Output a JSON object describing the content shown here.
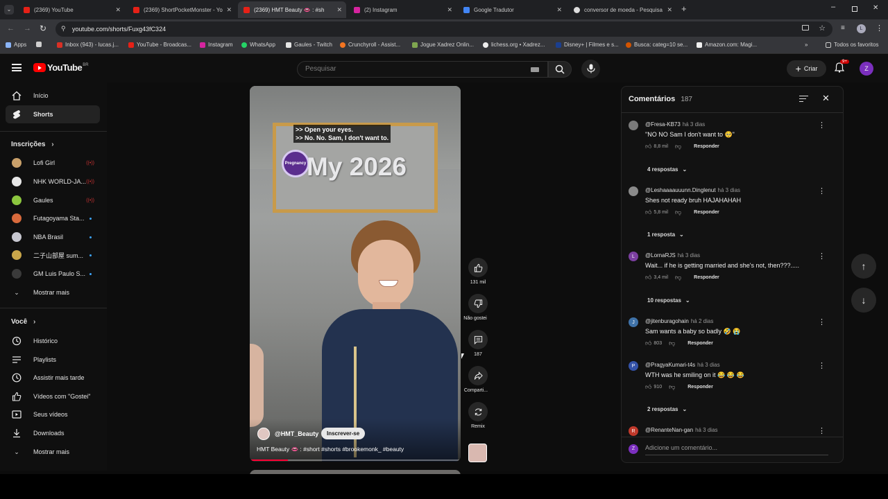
{
  "tabs": [
    {
      "title": "(2369) YouTube",
      "color": "#e62117"
    },
    {
      "title": "(2369) ShortPocketMonster - Yo",
      "color": "#e62117"
    },
    {
      "title": "(2369) HMT Beauty 👄 : #sh",
      "color": "#e62117"
    },
    {
      "title": "(2) Instagram",
      "color": "#d6249f"
    },
    {
      "title": "Google Tradutor",
      "color": "#4285f4"
    },
    {
      "title": "conversor de moeda - Pesquisa",
      "color": "#dddddd"
    }
  ],
  "url": "youtube.com/shorts/Fuxg43fC324",
  "bookmarks": [
    "Apps",
    "Inbox (943) - lucas.j...",
    "YouTube - Broadcas...",
    "Instagram",
    "WhatsApp",
    "Gaules - Twitch",
    "Crunchyroll - Assist...",
    "Jogue Xadrez Onlin...",
    "lichess.org • Xadrez...",
    "Disney+ | Filmes e s...",
    "Busca: categ=10 se...",
    "Amazon.com: Magi..."
  ],
  "bookmarks_all": "Todos os favoritos",
  "header": {
    "logo": "YouTube",
    "region": "BR",
    "search_placeholder": "Pesquisar",
    "create": "Criar",
    "notif_count": "9+",
    "user_initial": "Z"
  },
  "sidebar": {
    "home": "Início",
    "shorts": "Shorts",
    "subs_title": "Inscrições",
    "subs": [
      {
        "name": "Lofi Girl",
        "color": "#c9a06a",
        "badge": "live"
      },
      {
        "name": "NHK WORLD-JA...",
        "color": "#e7e7e7",
        "badge": "live"
      },
      {
        "name": "Gaules",
        "color": "#8cc63f",
        "badge": "live"
      },
      {
        "name": "Futagoyama Sta...",
        "color": "#d86a3c",
        "badge": "new"
      },
      {
        "name": "NBA Brasil",
        "color": "#c7c7d0",
        "badge": "new"
      },
      {
        "name": "二子山部屋 sum...",
        "color": "#c9a64a",
        "badge": "new"
      },
      {
        "name": "GM Luis Paulo S...",
        "color": "#3a3a3a",
        "badge": "new"
      }
    ],
    "show_more": "Mostrar mais",
    "you_title": "Você",
    "you_items": [
      "Histórico",
      "Playlists",
      "Assistir mais tarde",
      "Vídeos com \"Gostei\"",
      "Seus vídeos",
      "Downloads",
      "Mostrar mais"
    ]
  },
  "video": {
    "overlay_line1": ">> Open your eyes.",
    "overlay_line2": ">> No. No. Sam, I don't want to.",
    "badge": "Pregnancy",
    "sign_text": "My 2026",
    "channel": "@HMT_Beauty",
    "subscribe": "Inscrever-se",
    "caption": "HMT Beauty 👄 : #short #shorts #brookemonk_ #beauty"
  },
  "actions": {
    "likes": "131 mil",
    "dislike": "Não gostei",
    "comments": "187",
    "share": "Comparti...",
    "remix": "Remix"
  },
  "comments_panel": {
    "title": "Comentários",
    "count": "187",
    "add_placeholder": "Adicione um comentário...",
    "reply_label": "Responder",
    "items": [
      {
        "author": "@Fresa-KB73",
        "when": "há 3 dias",
        "text": "\"NO NO Sam I don't want to 🥺\"",
        "likes": "8,8 mil",
        "replies": "4 respostas",
        "color": "#7a7a7a",
        "initial": ""
      },
      {
        "author": "@Leshaaaauuunn.Dinglenut",
        "when": "há 3 dias",
        "text": "Shes not ready bruh HAJAHAHAH",
        "likes": "5,8 mil",
        "replies": "1 resposta",
        "color": "#8a8a8a",
        "initial": ""
      },
      {
        "author": "@LornaRJS",
        "when": "há 3 dias",
        "text": "Wait... if he is getting married and she's not, then???.....",
        "likes": "3,4 mil",
        "replies": "10 respostas",
        "color": "#7b3fa0",
        "initial": "L"
      },
      {
        "author": "@jitenburagohain",
        "when": "há 2 dias",
        "text": "Sam wants a baby so badly 🤣 😭",
        "likes": "803",
        "replies": "",
        "color": "#3f72a8",
        "initial": "J"
      },
      {
        "author": "@PragyaKumari-t4s",
        "when": "há 3 dias",
        "text": "WTH was he smiling on it 😂 😂 😂",
        "likes": "910",
        "replies": "2 respostas",
        "color": "#3452a8",
        "initial": "P"
      },
      {
        "author": "@RenanteNan-gan",
        "when": "há 3 dias",
        "text": "",
        "likes": "",
        "replies": "",
        "color": "#c0392b",
        "initial": "R"
      }
    ]
  }
}
